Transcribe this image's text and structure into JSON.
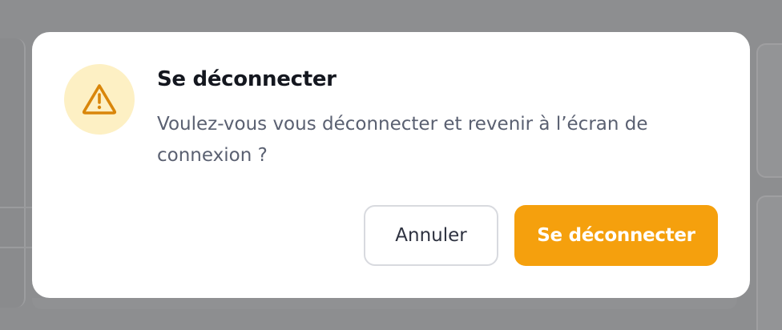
{
  "dialog": {
    "title": "Se déconnecter",
    "message": "Voulez-vous vous déconnecter et revenir à l’écran de connexion ?",
    "icon": "warning-triangle-icon",
    "cancel_label": "Annuler",
    "confirm_label": "Se déconnecter"
  },
  "colors": {
    "accent": "#f5a00d",
    "icon_bg": "#fdf0c4",
    "icon_stroke": "#d9860a",
    "title": "#14171f",
    "text": "#5a6071",
    "overlay": "#8d8e90"
  }
}
